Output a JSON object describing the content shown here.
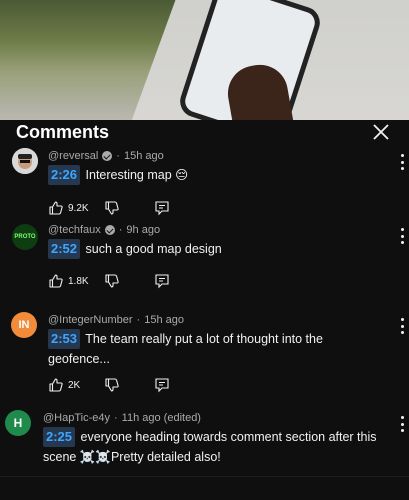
{
  "header": {
    "title": "Comments"
  },
  "comments": [
    {
      "author": "@reversal",
      "verified": true,
      "time": "15h ago",
      "timestamp": "2:26",
      "text": "Interesting map 😔",
      "likes": "9.2K",
      "avatar": {
        "kind": "photo",
        "color": "#d8d8d8"
      }
    },
    {
      "author": "@techfaux",
      "verified": true,
      "time": "9h ago",
      "timestamp": "2:52",
      "text": "such a good map design",
      "likes": "1.8K",
      "avatar": {
        "kind": "logo",
        "color": "#0e3d12"
      }
    },
    {
      "author": "@IntegerNumber",
      "verified": false,
      "time": "15h ago",
      "timestamp": "2:53",
      "text": "The team really put a lot of thought into the geofence...",
      "likes": "2K",
      "avatar": {
        "kind": "initials",
        "initials": "IN",
        "color": "#f28b3a"
      }
    },
    {
      "author": "@HapTic-e4y",
      "verified": false,
      "time": "11h ago (edited)",
      "timestamp": "2:25",
      "text": "everyone heading towards comment section after this scene ☠️☠️Pretty detailed also!",
      "avatar": {
        "kind": "initials",
        "initials": "H",
        "color": "#1f8a4c"
      }
    }
  ],
  "icons": {
    "close": "close-icon",
    "like": "thumbs-up-icon",
    "dislike": "thumbs-down-icon",
    "reply": "reply-icon",
    "more": "more-vert-icon",
    "verified": "verified-check-icon"
  },
  "colors": {
    "background": "#0f0f0f",
    "timestamp_link": "#3ea6ff",
    "timestamp_bg": "#263850"
  }
}
